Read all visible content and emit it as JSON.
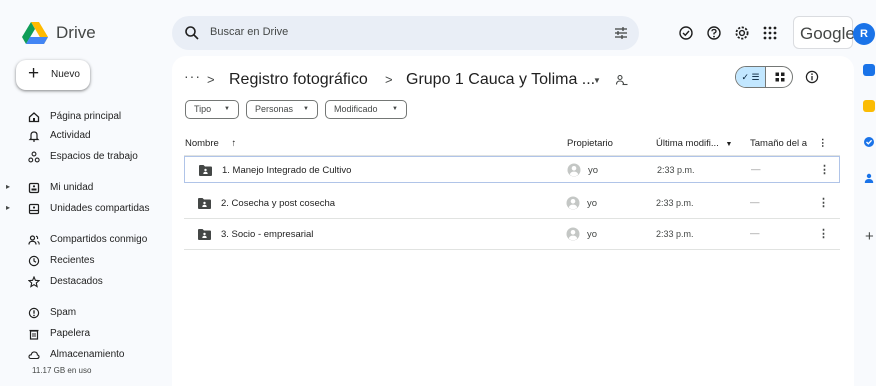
{
  "app": {
    "name": "Drive",
    "brand": "Google",
    "user_initial": "R"
  },
  "search": {
    "placeholder": "Buscar en Drive"
  },
  "nav": {
    "new_label": "Nuevo",
    "items": [
      {
        "label": "Página principal",
        "icon": "home-icon"
      },
      {
        "label": "Actividad",
        "icon": "bell-icon"
      },
      {
        "label": "Espacios de trabajo",
        "icon": "workspaces-icon"
      },
      {
        "label": "Mi unidad",
        "icon": "my-drive-icon",
        "expandable": true
      },
      {
        "label": "Unidades compartidas",
        "icon": "shared-drives-icon",
        "expandable": true
      },
      {
        "label": "Compartidos conmigo",
        "icon": "people-icon"
      },
      {
        "label": "Recientes",
        "icon": "clock-icon"
      },
      {
        "label": "Destacados",
        "icon": "star-icon"
      },
      {
        "label": "Spam",
        "icon": "spam-icon"
      },
      {
        "label": "Papelera",
        "icon": "trash-icon"
      },
      {
        "label": "Almacenamiento",
        "icon": "cloud-icon"
      }
    ],
    "storage_used": "11.17 GB en uso"
  },
  "breadcrumb": {
    "overflow": "···",
    "separator": ">",
    "parent": "Registro fotográfico",
    "current": "Grupo 1 Cauca y Tolima ..."
  },
  "filters": {
    "type": "Tipo",
    "people": "Personas",
    "modified": "Modificado"
  },
  "table": {
    "headers": {
      "name": "Nombre",
      "sort_arrow": "↑",
      "owner": "Propietario",
      "modified": "Última modifi...",
      "size": "Tamaño del a"
    },
    "rows": [
      {
        "name": "1. Manejo Integrado de Cultivo",
        "owner": "yo",
        "modified": "2:33 p.m.",
        "size": "—",
        "selected": true
      },
      {
        "name": "2. Cosecha y post cosecha",
        "owner": "yo",
        "modified": "2:33 p.m.",
        "size": "—",
        "selected": false
      },
      {
        "name": "3. Socio - empresarial",
        "owner": "yo",
        "modified": "2:33 p.m.",
        "size": "—",
        "selected": false
      }
    ]
  },
  "colors": {
    "background": "#f8fafd",
    "search_bg": "#e9eef6",
    "accent": "#1a73e8",
    "view_toggle_active": "#c2e7ff"
  }
}
